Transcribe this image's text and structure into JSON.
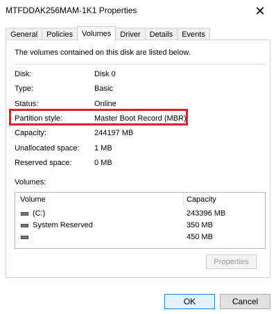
{
  "window": {
    "title": "MTFDDAK256MAM-1K1 Properties",
    "close_glyph": "✕"
  },
  "tabs": [
    {
      "label": "General"
    },
    {
      "label": "Policies"
    },
    {
      "label": "Volumes"
    },
    {
      "label": "Driver"
    },
    {
      "label": "Details"
    },
    {
      "label": "Events"
    }
  ],
  "active_tab": "Volumes",
  "intro": "The volumes contained on this disk are listed below.",
  "disk_info": {
    "disk": {
      "label": "Disk:",
      "value": "Disk 0"
    },
    "type": {
      "label": "Type:",
      "value": "Basic"
    },
    "status": {
      "label": "Status:",
      "value": "Online"
    },
    "partition_style": {
      "label": "Partition style:",
      "value": "Master Boot Record (MBR)"
    },
    "capacity": {
      "label": "Capacity:",
      "value": "244197 MB"
    },
    "unallocated": {
      "label": "Unallocated space:",
      "value": "1 MB"
    },
    "reserved": {
      "label": "Reserved space:",
      "value": "0 MB"
    }
  },
  "volumes": {
    "label": "Volumes:",
    "columns": [
      "Volume",
      "Capacity"
    ],
    "rows": [
      {
        "volume": "(C:)",
        "capacity": "243396 MB",
        "icon": "drive-icon"
      },
      {
        "volume": "System Reserved",
        "capacity": "350 MB",
        "icon": "drive-icon"
      },
      {
        "volume": "",
        "capacity": "450 MB",
        "icon": "drive-icon"
      }
    ]
  },
  "buttons": {
    "properties": "Properties",
    "ok": "OK",
    "cancel": "Cancel"
  },
  "colors": {
    "highlight": "#e0202c",
    "ok_border": "#0078d7"
  }
}
